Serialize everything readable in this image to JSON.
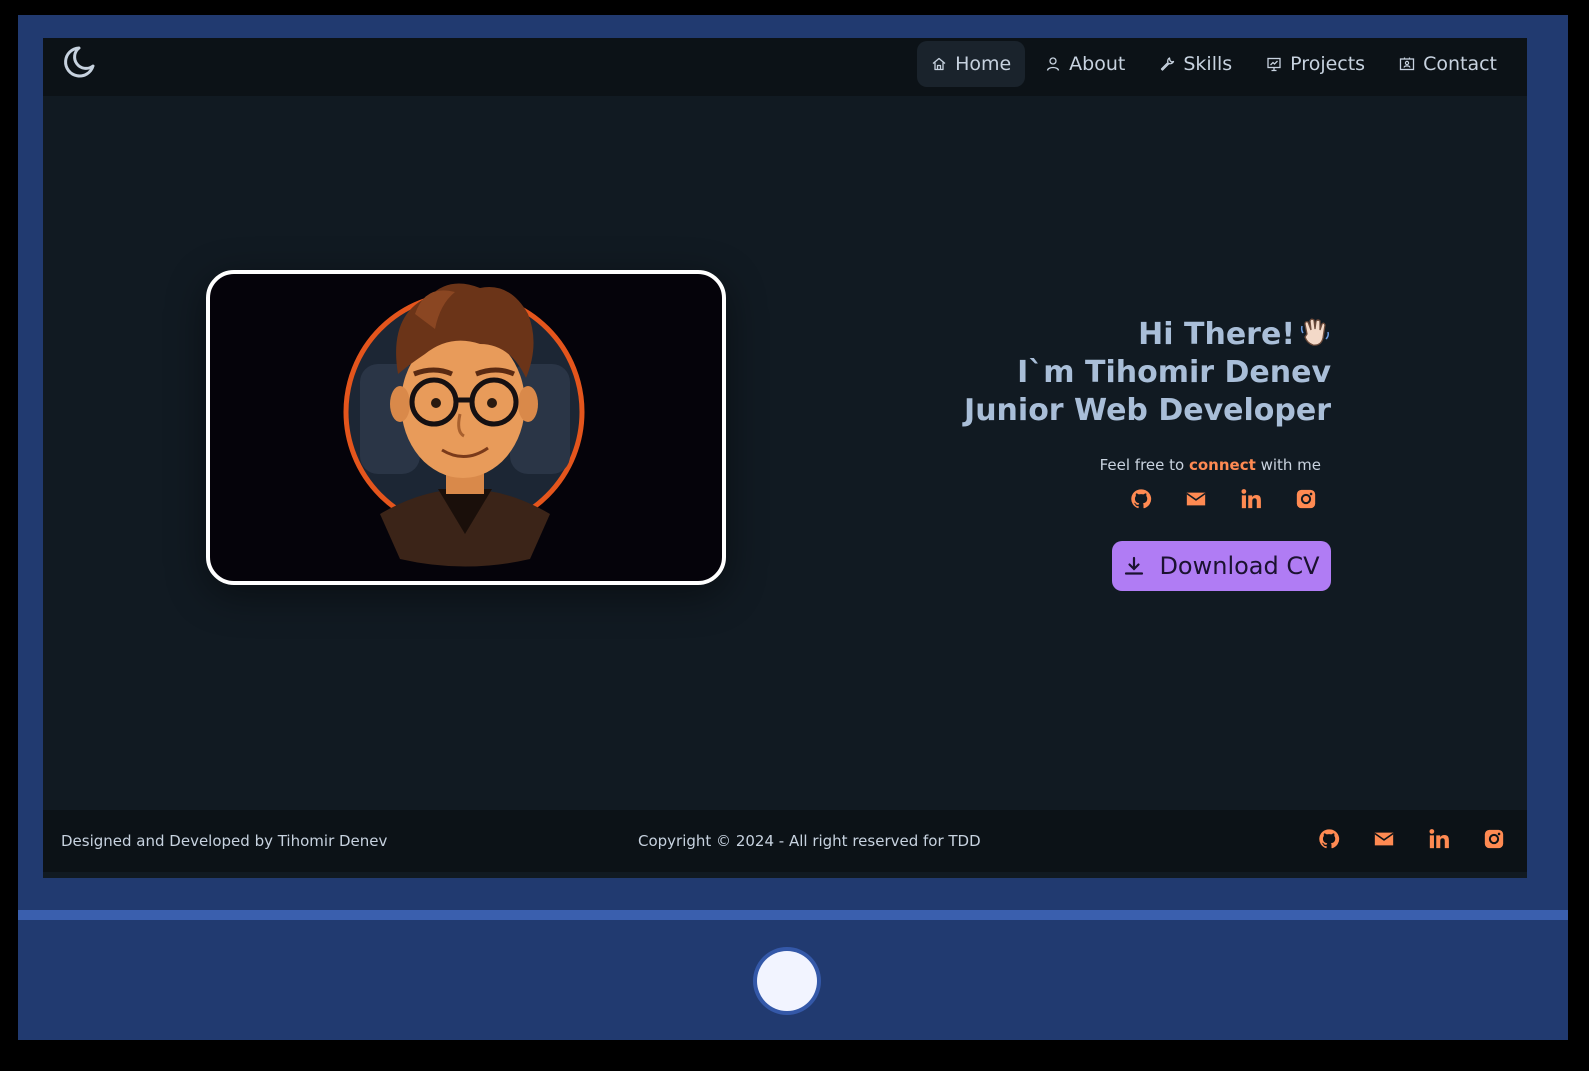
{
  "navbar": {
    "theme_icon": "moon-icon",
    "items": [
      {
        "label": "Home",
        "icon": "home-icon",
        "active": true
      },
      {
        "label": "About",
        "icon": "user-icon",
        "active": false
      },
      {
        "label": "Skills",
        "icon": "wrench-icon",
        "active": false
      },
      {
        "label": "Projects",
        "icon": "presentation-icon",
        "active": false
      },
      {
        "label": "Contact",
        "icon": "contact-card-icon",
        "active": false
      }
    ]
  },
  "hero": {
    "greeting": "Hi There!",
    "greeting_emoji": "waving-hand-icon",
    "name_line": "I`m Tihomir Denev",
    "role_line": "Junior Web Developer",
    "connect_prefix": "Feel free to",
    "connect_highlight": "connect",
    "connect_suffix": "with me",
    "cv_button": "Download CV",
    "avatar": "developer-avatar-illustration"
  },
  "socials": [
    "github-icon",
    "mail-icon",
    "linkedin-icon",
    "instagram-icon"
  ],
  "footer": {
    "credit": "Designed and Developed by Tihomir Denev",
    "copyright": "Copyright © 2024 - All right reserved for TDD"
  },
  "colors": {
    "accent": "#ff8a52",
    "button": "#b07cf4",
    "background": "#111a22",
    "heading": "#a9bed8",
    "monitor_frame": "#213a70"
  }
}
